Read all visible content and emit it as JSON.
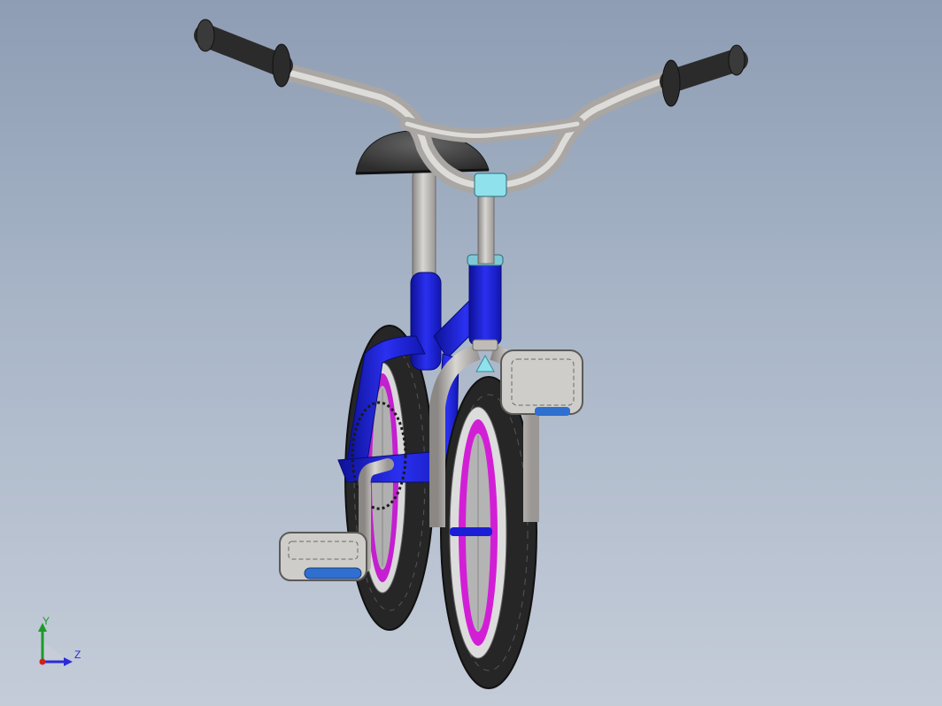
{
  "viewport": {
    "model": "kids-bicycle",
    "background_top": "#8e9db4",
    "background_bottom": "#c4ccd8"
  },
  "colors": {
    "frame": "#1a1fd6",
    "frame_shade": "#0d1196",
    "tube": "#bfbcb8",
    "tube_shade": "#8a8784",
    "tire": "#2a2a2a",
    "rim_accent": "#d21fd6",
    "headset": "#8fe1ec",
    "reflector": "#2f6fd0"
  },
  "triad": {
    "y_label": "Y",
    "z_label": "Z",
    "y_color": "#1c9a2a",
    "z_color": "#2b2bd8",
    "origin_color": "#d02020"
  }
}
